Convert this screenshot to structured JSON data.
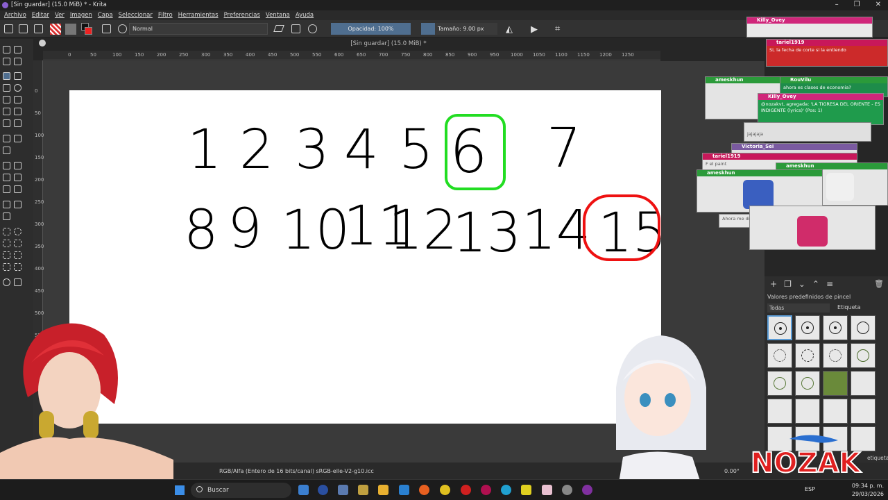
{
  "window": {
    "title": "[Sin guardar]  (15.0 MiB) * - Krita",
    "controls": [
      "–",
      "❐",
      "✕"
    ]
  },
  "menu": [
    "Archivo",
    "Editar",
    "Ver",
    "Imagen",
    "Capa",
    "Seleccionar",
    "Filtro",
    "Herramientas",
    "Preferencias",
    "Ventana",
    "Ayuda"
  ],
  "toolbar": {
    "blend_mode": "Normal",
    "opacity": "Opacidad: 100%",
    "size": "Tamaño: 9.00 px"
  },
  "document": {
    "tab_title": "[Sin guardar] (15.0 MiB) *"
  },
  "ruler": {
    "top_ticks": [
      "0",
      "50",
      "100",
      "150",
      "200",
      "250",
      "300",
      "350",
      "400",
      "450",
      "500",
      "550",
      "600",
      "650",
      "700",
      "750",
      "800",
      "850",
      "900",
      "950",
      "1000",
      "1050",
      "1100",
      "1150",
      "1200",
      "1250"
    ],
    "left_ticks": [
      "0",
      "50",
      "100",
      "150",
      "200",
      "250",
      "300",
      "350",
      "400",
      "450",
      "500",
      "550"
    ]
  },
  "canvas": {
    "row1": [
      "1",
      "2",
      "3",
      "4",
      "5",
      "6",
      "7"
    ],
    "row2": [
      "8",
      "9",
      "10",
      "11",
      "12",
      "13",
      "14",
      "15"
    ],
    "highlight_green": "6",
    "highlight_red": "15",
    "colors": {
      "green": "#22dd22",
      "red": "#ee1111"
    }
  },
  "status": {
    "color_info": "RGB/Alfa (Entero de 16 bits/canal)  sRGB-elle-V2-g10.icc",
    "rotation": "0.00°"
  },
  "brush_panel": {
    "title": "Valores predefinidos de pincel",
    "filter": "Todas",
    "tag_label": "Etiqueta",
    "tag_label_bottom": "etiqueta"
  },
  "chat_overlays": [
    {
      "user": "Killy_Ovey",
      "color": "#d0267a",
      "message": ""
    },
    {
      "user": "tariel1919",
      "color": "#c8185a",
      "message": "Si, la fecha de corte si la entiendo"
    },
    {
      "user": "ameskhun",
      "color": "#2b9a3a",
      "message": ""
    },
    {
      "user": "RouVilu",
      "color": "#2b9a3a",
      "message": "ahora es clases de economia?"
    },
    {
      "user": "Killy_Ovey",
      "color": "#d0267a",
      "message": "@nozakvt, agregada: 'LA TIGRESA DEL ORIENTE - ES INDIGENTE (lyrics)' (Pos: 1)"
    },
    {
      "user": "Victoria_Sei",
      "color": "#7a5aa0",
      "message": "jajajaja"
    },
    {
      "user": "tariel1919",
      "color": "#c8185a",
      "message": "F el paint"
    },
    {
      "user": "ameskhun",
      "color": "#2b9a3a",
      "message": ""
    },
    {
      "user": "ameskhun",
      "color": "#2b9a3a",
      "message": ""
    },
    {
      "user": "",
      "color": "#888888",
      "message": "Ahora me di"
    }
  ],
  "taskbar": {
    "search_placeholder": "Buscar",
    "language": "ESP",
    "time": "09:34 p. m.",
    "date": "29/03/2026"
  },
  "logo_text": "NOZAK"
}
